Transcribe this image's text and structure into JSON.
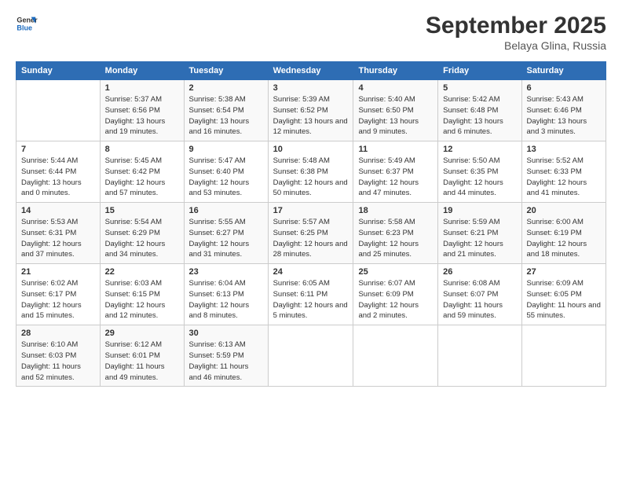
{
  "logo": {
    "line1": "General",
    "line2": "Blue"
  },
  "title": "September 2025",
  "location": "Belaya Glina, Russia",
  "weekdays": [
    "Sunday",
    "Monday",
    "Tuesday",
    "Wednesday",
    "Thursday",
    "Friday",
    "Saturday"
  ],
  "weeks": [
    [
      {
        "day": "",
        "sunrise": "",
        "sunset": "",
        "daylight": ""
      },
      {
        "day": "1",
        "sunrise": "Sunrise: 5:37 AM",
        "sunset": "Sunset: 6:56 PM",
        "daylight": "Daylight: 13 hours and 19 minutes."
      },
      {
        "day": "2",
        "sunrise": "Sunrise: 5:38 AM",
        "sunset": "Sunset: 6:54 PM",
        "daylight": "Daylight: 13 hours and 16 minutes."
      },
      {
        "day": "3",
        "sunrise": "Sunrise: 5:39 AM",
        "sunset": "Sunset: 6:52 PM",
        "daylight": "Daylight: 13 hours and 12 minutes."
      },
      {
        "day": "4",
        "sunrise": "Sunrise: 5:40 AM",
        "sunset": "Sunset: 6:50 PM",
        "daylight": "Daylight: 13 hours and 9 minutes."
      },
      {
        "day": "5",
        "sunrise": "Sunrise: 5:42 AM",
        "sunset": "Sunset: 6:48 PM",
        "daylight": "Daylight: 13 hours and 6 minutes."
      },
      {
        "day": "6",
        "sunrise": "Sunrise: 5:43 AM",
        "sunset": "Sunset: 6:46 PM",
        "daylight": "Daylight: 13 hours and 3 minutes."
      }
    ],
    [
      {
        "day": "7",
        "sunrise": "Sunrise: 5:44 AM",
        "sunset": "Sunset: 6:44 PM",
        "daylight": "Daylight: 13 hours and 0 minutes."
      },
      {
        "day": "8",
        "sunrise": "Sunrise: 5:45 AM",
        "sunset": "Sunset: 6:42 PM",
        "daylight": "Daylight: 12 hours and 57 minutes."
      },
      {
        "day": "9",
        "sunrise": "Sunrise: 5:47 AM",
        "sunset": "Sunset: 6:40 PM",
        "daylight": "Daylight: 12 hours and 53 minutes."
      },
      {
        "day": "10",
        "sunrise": "Sunrise: 5:48 AM",
        "sunset": "Sunset: 6:38 PM",
        "daylight": "Daylight: 12 hours and 50 minutes."
      },
      {
        "day": "11",
        "sunrise": "Sunrise: 5:49 AM",
        "sunset": "Sunset: 6:37 PM",
        "daylight": "Daylight: 12 hours and 47 minutes."
      },
      {
        "day": "12",
        "sunrise": "Sunrise: 5:50 AM",
        "sunset": "Sunset: 6:35 PM",
        "daylight": "Daylight: 12 hours and 44 minutes."
      },
      {
        "day": "13",
        "sunrise": "Sunrise: 5:52 AM",
        "sunset": "Sunset: 6:33 PM",
        "daylight": "Daylight: 12 hours and 41 minutes."
      }
    ],
    [
      {
        "day": "14",
        "sunrise": "Sunrise: 5:53 AM",
        "sunset": "Sunset: 6:31 PM",
        "daylight": "Daylight: 12 hours and 37 minutes."
      },
      {
        "day": "15",
        "sunrise": "Sunrise: 5:54 AM",
        "sunset": "Sunset: 6:29 PM",
        "daylight": "Daylight: 12 hours and 34 minutes."
      },
      {
        "day": "16",
        "sunrise": "Sunrise: 5:55 AM",
        "sunset": "Sunset: 6:27 PM",
        "daylight": "Daylight: 12 hours and 31 minutes."
      },
      {
        "day": "17",
        "sunrise": "Sunrise: 5:57 AM",
        "sunset": "Sunset: 6:25 PM",
        "daylight": "Daylight: 12 hours and 28 minutes."
      },
      {
        "day": "18",
        "sunrise": "Sunrise: 5:58 AM",
        "sunset": "Sunset: 6:23 PM",
        "daylight": "Daylight: 12 hours and 25 minutes."
      },
      {
        "day": "19",
        "sunrise": "Sunrise: 5:59 AM",
        "sunset": "Sunset: 6:21 PM",
        "daylight": "Daylight: 12 hours and 21 minutes."
      },
      {
        "day": "20",
        "sunrise": "Sunrise: 6:00 AM",
        "sunset": "Sunset: 6:19 PM",
        "daylight": "Daylight: 12 hours and 18 minutes."
      }
    ],
    [
      {
        "day": "21",
        "sunrise": "Sunrise: 6:02 AM",
        "sunset": "Sunset: 6:17 PM",
        "daylight": "Daylight: 12 hours and 15 minutes."
      },
      {
        "day": "22",
        "sunrise": "Sunrise: 6:03 AM",
        "sunset": "Sunset: 6:15 PM",
        "daylight": "Daylight: 12 hours and 12 minutes."
      },
      {
        "day": "23",
        "sunrise": "Sunrise: 6:04 AM",
        "sunset": "Sunset: 6:13 PM",
        "daylight": "Daylight: 12 hours and 8 minutes."
      },
      {
        "day": "24",
        "sunrise": "Sunrise: 6:05 AM",
        "sunset": "Sunset: 6:11 PM",
        "daylight": "Daylight: 12 hours and 5 minutes."
      },
      {
        "day": "25",
        "sunrise": "Sunrise: 6:07 AM",
        "sunset": "Sunset: 6:09 PM",
        "daylight": "Daylight: 12 hours and 2 minutes."
      },
      {
        "day": "26",
        "sunrise": "Sunrise: 6:08 AM",
        "sunset": "Sunset: 6:07 PM",
        "daylight": "Daylight: 11 hours and 59 minutes."
      },
      {
        "day": "27",
        "sunrise": "Sunrise: 6:09 AM",
        "sunset": "Sunset: 6:05 PM",
        "daylight": "Daylight: 11 hours and 55 minutes."
      }
    ],
    [
      {
        "day": "28",
        "sunrise": "Sunrise: 6:10 AM",
        "sunset": "Sunset: 6:03 PM",
        "daylight": "Daylight: 11 hours and 52 minutes."
      },
      {
        "day": "29",
        "sunrise": "Sunrise: 6:12 AM",
        "sunset": "Sunset: 6:01 PM",
        "daylight": "Daylight: 11 hours and 49 minutes."
      },
      {
        "day": "30",
        "sunrise": "Sunrise: 6:13 AM",
        "sunset": "Sunset: 5:59 PM",
        "daylight": "Daylight: 11 hours and 46 minutes."
      },
      {
        "day": "",
        "sunrise": "",
        "sunset": "",
        "daylight": ""
      },
      {
        "day": "",
        "sunrise": "",
        "sunset": "",
        "daylight": ""
      },
      {
        "day": "",
        "sunrise": "",
        "sunset": "",
        "daylight": ""
      },
      {
        "day": "",
        "sunrise": "",
        "sunset": "",
        "daylight": ""
      }
    ]
  ]
}
